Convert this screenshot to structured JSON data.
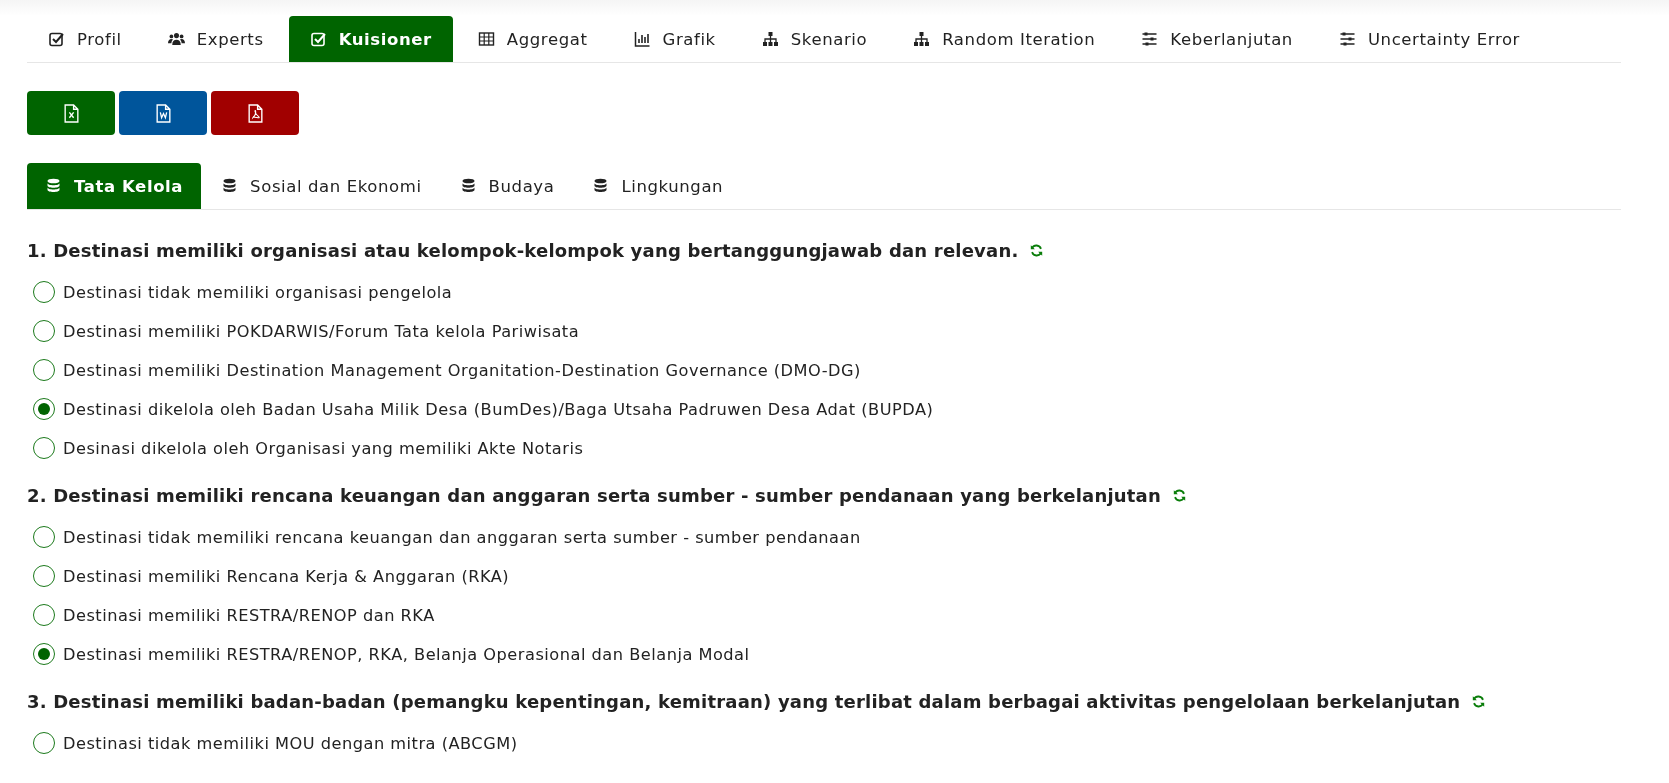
{
  "main_tabs": [
    {
      "label": "Profil",
      "kind": "check",
      "selected": false
    },
    {
      "label": "Experts",
      "kind": "users",
      "selected": false
    },
    {
      "label": "Kuisioner",
      "kind": "check",
      "selected": true
    },
    {
      "label": "Aggregat",
      "kind": "table",
      "selected": false
    },
    {
      "label": "Grafik",
      "kind": "chart",
      "selected": false
    },
    {
      "label": "Skenario",
      "kind": "sitemap",
      "selected": false
    },
    {
      "label": "Random Iteration",
      "kind": "sitemap",
      "selected": false
    },
    {
      "label": "Keberlanjutan",
      "kind": "sliders",
      "selected": false
    },
    {
      "label": "Uncertainty Error",
      "kind": "sliders",
      "selected": false
    }
  ],
  "export_buttons": [
    {
      "kind": "excel"
    },
    {
      "kind": "word"
    },
    {
      "kind": "pdf"
    }
  ],
  "category_tabs": [
    {
      "label": "Tata Kelola",
      "selected": true
    },
    {
      "label": "Sosial dan Ekonomi",
      "selected": false
    },
    {
      "label": "Budaya",
      "selected": false
    },
    {
      "label": "Lingkungan",
      "selected": false
    }
  ],
  "questions": [
    {
      "title": "1. Destinasi memiliki organisasi atau kelompok-kelompok yang bertanggungjawab dan relevan.",
      "options": [
        {
          "label": "Destinasi tidak memiliki organisasi pengelola",
          "selected": false
        },
        {
          "label": "Destinasi memiliki POKDARWIS/Forum Tata kelola Pariwisata",
          "selected": false
        },
        {
          "label": "Destinasi memiliki Destination Management Organitation-Destination Governance (DMO-DG)",
          "selected": false
        },
        {
          "label": "Destinasi dikelola oleh Badan Usaha Milik Desa (BumDes)/Baga Utsaha Padruwen Desa Adat (BUPDA)",
          "selected": true
        },
        {
          "label": "Desinasi dikelola oleh Organisasi yang memiliki Akte Notaris",
          "selected": false
        }
      ]
    },
    {
      "title": "2. Destinasi memiliki rencana keuangan dan anggaran serta sumber - sumber pendanaan yang berkelanjutan",
      "options": [
        {
          "label": "Destinasi tidak memiliki rencana keuangan dan anggaran serta sumber - sumber pendanaan",
          "selected": false
        },
        {
          "label": "Destinasi memiliki Rencana Kerja & Anggaran (RKA)",
          "selected": false
        },
        {
          "label": "Destinasi memiliki RESTRA/RENOP dan RKA",
          "selected": false
        },
        {
          "label": "Destinasi memiliki RESTRA/RENOP, RKA, Belanja Operasional dan Belanja Modal",
          "selected": true
        }
      ]
    },
    {
      "title": "3. Destinasi memiliki badan-badan (pemangku kepentingan, kemitraan) yang terlibat dalam berbagai aktivitas pengelolaan berkelanjutan",
      "options": [
        {
          "label": "Destinasi tidak memiliki MOU dengan mitra (ABCGM)",
          "selected": false
        }
      ]
    }
  ]
}
